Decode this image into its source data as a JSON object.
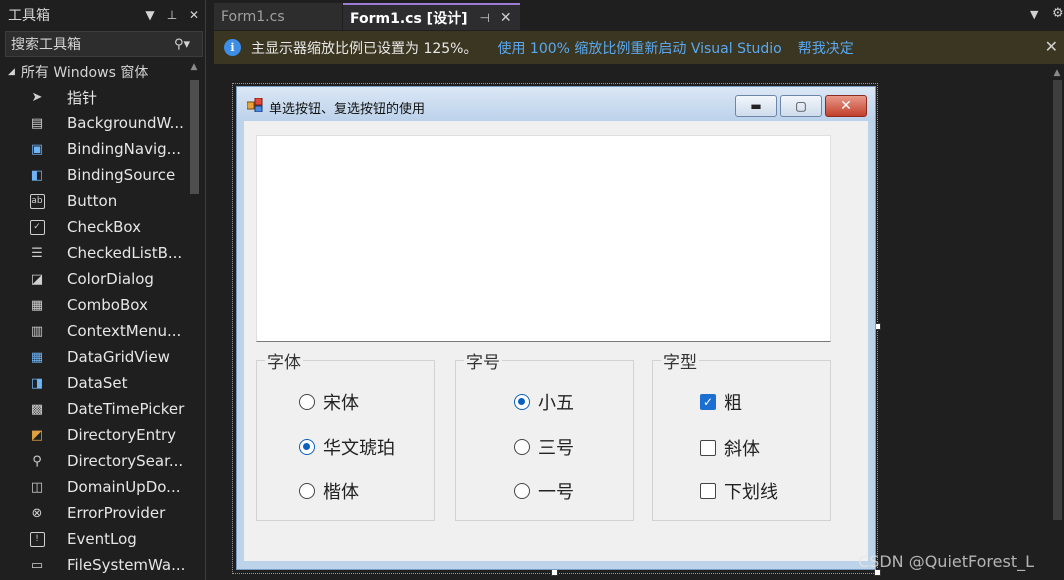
{
  "toolbox": {
    "title": "工具箱",
    "dropdown_icon": "▼",
    "pin_icon": "🖈",
    "close_icon": "✕",
    "search_placeholder": "搜索工具箱",
    "group_label": "所有 Windows 窗体",
    "items": [
      {
        "label": "指针",
        "icon": "pointer-icon"
      },
      {
        "label": "BackgroundW...",
        "icon": "backgroundworker-icon"
      },
      {
        "label": "BindingNavig...",
        "icon": "bindingnavigator-icon"
      },
      {
        "label": "BindingSource",
        "icon": "bindingsource-icon"
      },
      {
        "label": "Button",
        "icon": "button-icon"
      },
      {
        "label": "CheckBox",
        "icon": "checkbox-icon"
      },
      {
        "label": "CheckedListB...",
        "icon": "checkedlistbox-icon"
      },
      {
        "label": "ColorDialog",
        "icon": "colordialog-icon"
      },
      {
        "label": "ComboBox",
        "icon": "combobox-icon"
      },
      {
        "label": "ContextMenu...",
        "icon": "contextmenu-icon"
      },
      {
        "label": "DataGridView",
        "icon": "datagridview-icon"
      },
      {
        "label": "DataSet",
        "icon": "dataset-icon"
      },
      {
        "label": "DateTimePicker",
        "icon": "datetimepicker-icon"
      },
      {
        "label": "DirectoryEntry",
        "icon": "directoryentry-icon"
      },
      {
        "label": "DirectorySear...",
        "icon": "directorysearcher-icon"
      },
      {
        "label": "DomainUpDo...",
        "icon": "domainupdown-icon"
      },
      {
        "label": "ErrorProvider",
        "icon": "errorprovider-icon"
      },
      {
        "label": "EventLog",
        "icon": "eventlog-icon"
      },
      {
        "label": "FileSystemWa...",
        "icon": "filesystemwatcher-icon"
      }
    ]
  },
  "tabs": [
    {
      "label": "Form1.cs",
      "active": false
    },
    {
      "label": "Form1.cs [设计]",
      "active": true
    }
  ],
  "infobar": {
    "message": "主显示器缩放比例已设置为 125%。",
    "link_restart": "使用 100% 缩放比例重新启动 Visual Studio",
    "link_help": "帮我决定"
  },
  "form": {
    "title": "单选按钮、复选按钮的使用",
    "groups": {
      "font": {
        "title": "字体",
        "options": [
          {
            "label": "宋体",
            "checked": false
          },
          {
            "label": "华文琥珀",
            "checked": true
          },
          {
            "label": "楷体",
            "checked": false
          }
        ]
      },
      "size": {
        "title": "字号",
        "options": [
          {
            "label": "小五",
            "checked": true
          },
          {
            "label": "三号",
            "checked": false
          },
          {
            "label": "一号",
            "checked": false
          }
        ]
      },
      "style": {
        "title": "字型",
        "options": [
          {
            "label": "粗",
            "checked": true
          },
          {
            "label": "斜体",
            "checked": false
          },
          {
            "label": "下划线",
            "checked": false
          }
        ]
      }
    }
  },
  "watermark": "CSDN @QuietForest_L",
  "colors": {
    "ide_background": "#1f1f1f",
    "infobar_background": "#3b3621",
    "link": "#5aa9f0",
    "active_tab_accent": "#9d7cd8",
    "radio_checked": "#0a5fbf"
  }
}
